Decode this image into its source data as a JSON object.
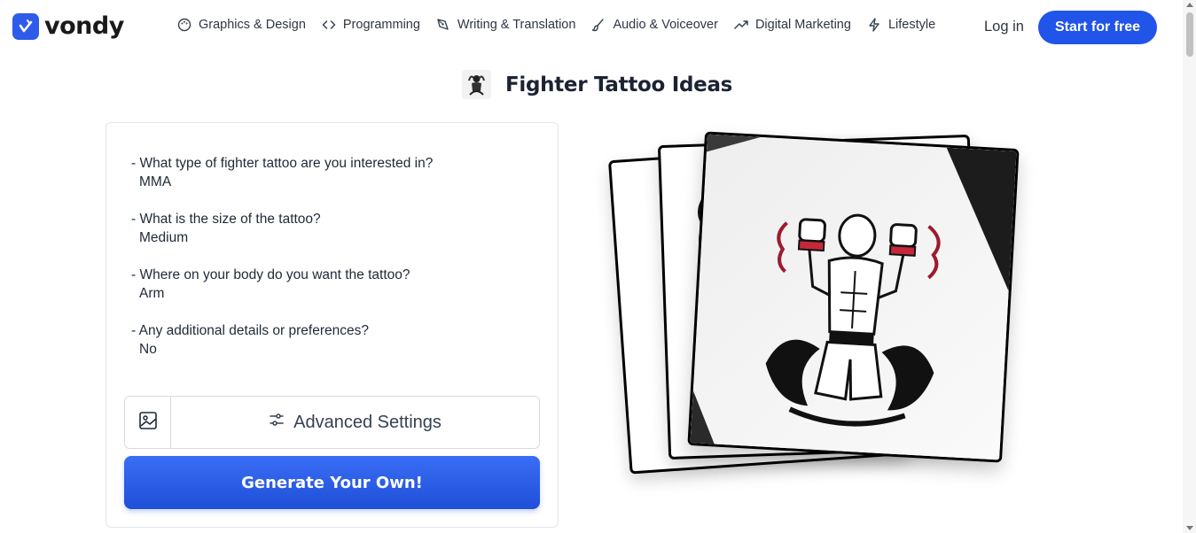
{
  "header": {
    "brand": "vondy",
    "nav": [
      {
        "label": "Graphics & Design",
        "icon": "palette-icon"
      },
      {
        "label": "Programming",
        "icon": "code-icon"
      },
      {
        "label": "Writing & Translation",
        "icon": "pen-nib-icon"
      },
      {
        "label": "Audio & Voiceover",
        "icon": "brush-icon"
      },
      {
        "label": "Digital Marketing",
        "icon": "trend-up-icon"
      },
      {
        "label": "Lifestyle",
        "icon": "lightning-icon"
      }
    ],
    "login_label": "Log in",
    "start_label": "Start for free"
  },
  "page": {
    "title": "Fighter Tattoo Ideas"
  },
  "form": {
    "items": [
      {
        "question": "- What type of fighter tattoo are you interested in?",
        "answer": "MMA"
      },
      {
        "question": "- What is the size of the tattoo?",
        "answer": "Medium"
      },
      {
        "question": "- Where on your body do you want the tattoo?",
        "answer": "Arm"
      },
      {
        "question": "- Any additional details or preferences?",
        "answer": "No"
      }
    ],
    "advanced_label": "Advanced Settings",
    "generate_label": "Generate Your Own!"
  },
  "colors": {
    "accent": "#2154e8",
    "text": "#1f2937",
    "border": "#e3e5e8"
  }
}
